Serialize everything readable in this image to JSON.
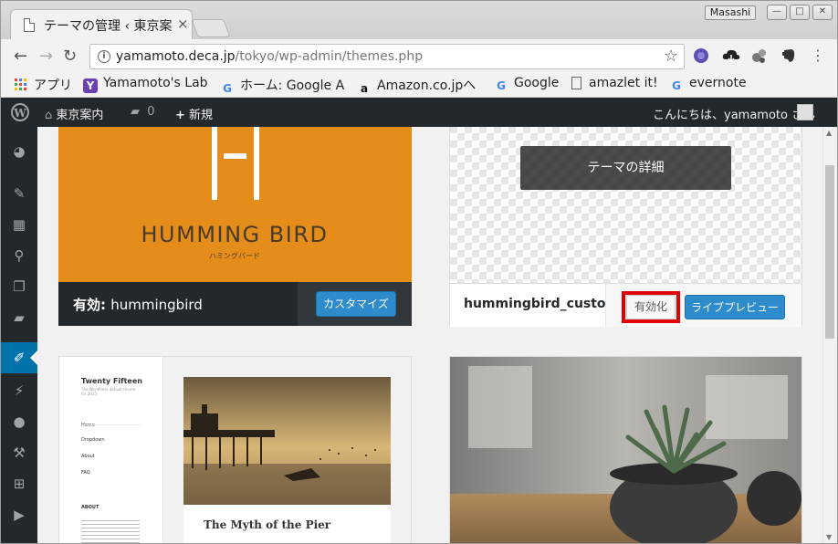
{
  "browser": {
    "tab_title": "テーマの管理 ‹ 東京案",
    "tab_close": "×",
    "profile_name": "Masashi",
    "url_host": "yamamoto.deca.jp",
    "url_path": "/tokyo/wp-admin/themes.php"
  },
  "bookmarks": [
    {
      "label": "アプリ",
      "icon": "apps-grid-icon"
    },
    {
      "label": "Yamamoto's Lab",
      "icon": "yahoo-y-icon"
    },
    {
      "label": "ホーム: Google A",
      "icon": "google-g-icon"
    },
    {
      "label": "Amazon.co.jpへ",
      "icon": "amazon-a-icon"
    },
    {
      "label": "Google",
      "icon": "google-g-icon"
    },
    {
      "label": "amazlet it!",
      "icon": "page-icon"
    },
    {
      "label": "evernote",
      "icon": "google-g-icon"
    }
  ],
  "adminbar": {
    "site_name": "東京案内",
    "comments_count": "0",
    "new_label": "新規",
    "greeting": "こんにちは、yamamoto さん"
  },
  "themes": {
    "active": {
      "logo_title": "HUMMING BIRD",
      "logo_sub": "ハミングバード",
      "footer_prefix": "有効: ",
      "name": "hummingbird",
      "customize_label": "カスタマイズ"
    },
    "custom": {
      "details_label": "テーマの詳細",
      "name": "hummingbird_custom",
      "activate_label": "有効化",
      "preview_label": "ライブプレビュー"
    },
    "twentyfifteen": {
      "site_title": "Twenty Fifteen",
      "tagline": "The WordPress default theme for 2015",
      "menu": [
        "Home",
        "Dropdown",
        "About",
        "FAQ"
      ],
      "widget_title": "ABOUT",
      "post_title": "The Myth of the Pier"
    }
  },
  "colors": {
    "wp_dark": "#23282d",
    "wp_blue": "#0073aa",
    "hummingbird_orange": "#e58d1a",
    "highlight_red": "#e00000"
  }
}
